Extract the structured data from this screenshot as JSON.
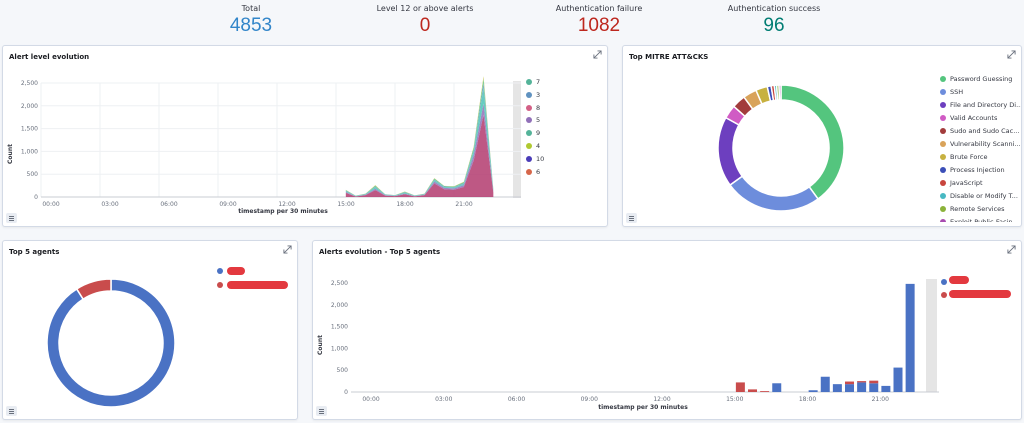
{
  "metrics": [
    {
      "label": "Total",
      "value": "4853",
      "color": "#3185c9"
    },
    {
      "label": "Level 12 or above alerts",
      "value": "0",
      "color": "#bd271e"
    },
    {
      "label": "Authentication failure",
      "value": "1082",
      "color": "#bd271e"
    },
    {
      "label": "Authentication success",
      "value": "96",
      "color": "#017d73"
    }
  ],
  "panels": {
    "alert_level": {
      "title": "Alert level evolution",
      "ylabel": "Count",
      "xlabel": "timestamp per 30 minutes"
    },
    "mitre": {
      "title": "Top MITRE ATT&CKS"
    },
    "top_agents": {
      "title": "Top 5 agents"
    },
    "agents_evo": {
      "title": "Alerts evolution - Top 5 agents",
      "ylabel": "Count",
      "xlabel": "timestamp per 30 minutes"
    }
  },
  "alert_levels_legend": [
    {
      "label": "7",
      "color": "#54b399"
    },
    {
      "label": "3",
      "color": "#6092c0"
    },
    {
      "label": "8",
      "color": "#d36086"
    },
    {
      "label": "5",
      "color": "#9170b8"
    },
    {
      "label": "9",
      "color": "#54b399"
    },
    {
      "label": "4",
      "color": "#b0c931"
    },
    {
      "label": "10",
      "color": "#4a3cb8"
    },
    {
      "label": "6",
      "color": "#d6664a"
    }
  ],
  "mitre_legend": [
    {
      "label": "Password Guessing",
      "color": "#54c57e"
    },
    {
      "label": "SSH",
      "color": "#6d8ddc"
    },
    {
      "label": "File and Directory Di...",
      "color": "#6d3fbf"
    },
    {
      "label": "Valid Accounts",
      "color": "#d05bc4"
    },
    {
      "label": "Sudo and Sudo Cac...",
      "color": "#a23c3c"
    },
    {
      "label": "Vulnerability Scanni...",
      "color": "#d9a35a"
    },
    {
      "label": "Brute Force",
      "color": "#c7b140"
    },
    {
      "label": "Process Injection",
      "color": "#3b4fb8"
    },
    {
      "label": "JavaScript",
      "color": "#c8453e"
    },
    {
      "label": "Disable or Modify T...",
      "color": "#48b8c2"
    },
    {
      "label": "Remote Services",
      "color": "#8bb23a"
    },
    {
      "label": "Exploit Public-Facin...",
      "color": "#a84bb0"
    }
  ],
  "agents_legend_colors": [
    "#4a72c4",
    "#c94c4c"
  ],
  "chart_data": [
    {
      "type": "area",
      "title": "Alert level evolution",
      "xlabel": "timestamp per 30 minutes",
      "ylabel": "Count",
      "x_ticks": [
        "00:00",
        "03:00",
        "06:00",
        "09:00",
        "12:00",
        "15:00",
        "18:00",
        "21:00"
      ],
      "ylim": [
        0,
        2500
      ],
      "y_ticks": [
        0,
        500,
        1000,
        1500,
        2000,
        2500
      ],
      "x_hours": [
        15.5,
        16.0,
        16.5,
        17.0,
        17.5,
        18.0,
        18.5,
        19.0,
        19.5,
        20.0,
        20.5,
        21.0,
        21.5,
        22.0,
        22.5,
        23.0
      ],
      "series": [
        {
          "name": "7",
          "values": [
            20,
            5,
            10,
            40,
            10,
            5,
            20,
            5,
            10,
            30,
            20,
            20,
            30,
            80,
            350,
            30
          ]
        },
        {
          "name": "3",
          "values": [
            10,
            5,
            5,
            10,
            5,
            5,
            10,
            5,
            5,
            15,
            10,
            10,
            15,
            30,
            100,
            10
          ]
        },
        {
          "name": "8",
          "values": [
            90,
            10,
            40,
            150,
            30,
            20,
            60,
            15,
            40,
            300,
            170,
            160,
            220,
            800,
            1800,
            100
          ]
        },
        {
          "name": "5",
          "values": [
            20,
            5,
            10,
            30,
            10,
            5,
            15,
            5,
            10,
            40,
            30,
            30,
            40,
            120,
            250,
            20
          ]
        },
        {
          "name": "9",
          "values": [
            10,
            5,
            5,
            20,
            5,
            5,
            10,
            5,
            5,
            20,
            10,
            10,
            20,
            50,
            100,
            10
          ]
        },
        {
          "name": "4",
          "values": [
            5,
            0,
            5,
            10,
            0,
            0,
            5,
            0,
            5,
            10,
            5,
            5,
            10,
            20,
            50,
            5
          ]
        }
      ]
    },
    {
      "type": "pie",
      "title": "Top MITRE ATT&CKS",
      "categories": [
        "Password Guessing",
        "SSH",
        "File and Directory Di...",
        "Valid Accounts",
        "Sudo and Sudo Cac...",
        "Vulnerability Scanni...",
        "Brute Force",
        "Process Injection",
        "JavaScript",
        "Disable or Modify T...",
        "Remote Services",
        "Exploit Public-Facin..."
      ],
      "values": [
        40,
        25,
        18,
        3.5,
        3.5,
        3.5,
        3,
        1,
        0.8,
        0.6,
        0.6,
        0.5
      ]
    },
    {
      "type": "pie",
      "title": "Top 5 agents",
      "values": [
        91,
        9
      ]
    },
    {
      "type": "bar",
      "title": "Alerts evolution - Top 5 agents",
      "xlabel": "timestamp per 30 minutes",
      "ylabel": "Count",
      "x_ticks": [
        "00:00",
        "03:00",
        "06:00",
        "09:00",
        "12:00",
        "15:00",
        "18:00",
        "21:00"
      ],
      "ylim": [
        0,
        2500
      ],
      "y_ticks": [
        0,
        500,
        1000,
        1500,
        2000,
        2500
      ],
      "x_hours": [
        15.5,
        16.0,
        16.5,
        17.0,
        17.5,
        18.0,
        18.5,
        19.0,
        19.5,
        20.0,
        20.5,
        21.0,
        21.5,
        22.0,
        22.5
      ],
      "series": [
        {
          "color": "#4a72c4",
          "values": [
            0,
            0,
            0,
            200,
            0,
            0,
            40,
            350,
            180,
            180,
            220,
            200,
            140,
            560,
            2480
          ]
        },
        {
          "color": "#c94c4c",
          "values": [
            220,
            60,
            20,
            0,
            0,
            0,
            0,
            0,
            0,
            60,
            30,
            60,
            0,
            0,
            0
          ]
        }
      ]
    }
  ]
}
